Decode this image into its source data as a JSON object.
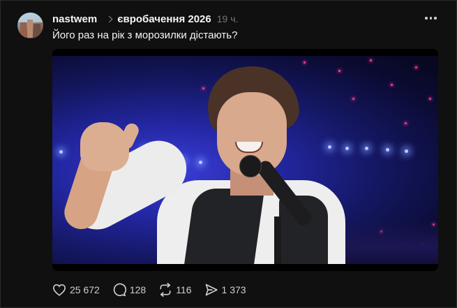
{
  "post": {
    "username": "nastwem",
    "topic": "євробачення 2026",
    "time": "19 ч.",
    "text": "Його раз на рік з морозилки дістають?"
  },
  "actions": {
    "likes": "25 672",
    "comments": "128",
    "reposts": "116",
    "shares": "1 373"
  },
  "icons": {
    "like": "heart-icon",
    "comment": "comment-bubble-icon",
    "repost": "repost-arrows-icon",
    "share": "send-icon",
    "more": "more-dots-icon",
    "topic_separator": "chevron-right-icon"
  },
  "colors": {
    "background": "#101010",
    "text_primary": "#f3f5f7",
    "text_secondary": "#777777"
  }
}
